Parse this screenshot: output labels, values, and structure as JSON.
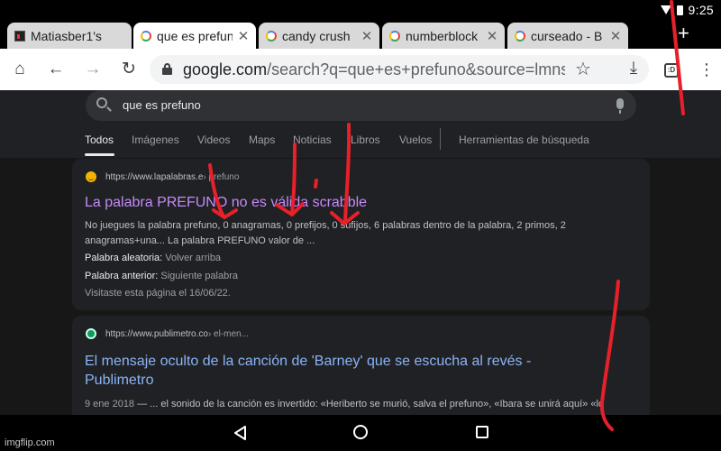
{
  "status": {
    "time": "9:25"
  },
  "tabs": [
    {
      "title": "Matiasber1's",
      "icon": "site-icon",
      "active": false
    },
    {
      "title": "que es prefuno",
      "icon": "google-icon",
      "active": true
    },
    {
      "title": "candy crush",
      "icon": "google-icon",
      "active": false
    },
    {
      "title": "numberblock",
      "icon": "google-icon",
      "active": false
    },
    {
      "title": "curseado - B",
      "icon": "google-icon",
      "active": false
    }
  ],
  "toolbar": {
    "url_domain": "google.com",
    "url_path": "/search?q=que+es+prefuno&source=lmns&bih",
    "tab_count": ":D"
  },
  "search": {
    "query": "que es prefuno"
  },
  "nav": {
    "items": [
      "Todos",
      "Imágenes",
      "Videos",
      "Maps",
      "Noticias",
      "Libros",
      "Vuelos"
    ],
    "tools": "Herramientas de búsqueda"
  },
  "results": [
    {
      "site": "https://www.lapalabras.e",
      "crumb": " › prefuno",
      "title": "La palabra PREFUNO no es válida scrabble",
      "snippet": "No juegues la palabra prefuno, 0 anagramas, 0 prefijos, 0 sufijos, 6 palabras dentro de la palabra, 2 primos, 2 anagramas+una... La palabra PREFUNO valor de ...",
      "line1_key": "Palabra aleatoria:",
      "line1_val": "Volver arriba",
      "line2_key": "Palabra anterior:",
      "line2_val": "Siguiente palabra",
      "visited": "Visitaste esta página el 16/06/22."
    },
    {
      "site": "https://www.publimetro.co",
      "crumb": " › el-men...",
      "title": "El mensaje oculto de la canción de 'Barney' que se escucha al revés - Publimetro",
      "date": "9 ene 2018",
      "snippet": " — ... el sonido de la canción es invertido: «Heriberto se murió, salva el prefuno», «Ibara se unirá aquí» «lo"
    }
  ],
  "watermark": "imgflip.com",
  "colors": {
    "annotation": "#e8202a",
    "visited_link": "#c58af9",
    "link": "#8ab4f8"
  }
}
